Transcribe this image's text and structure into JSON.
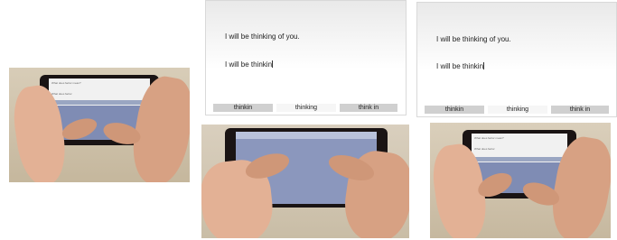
{
  "panels": [
    {
      "sentence": "I will be thinking of you.",
      "typed": "I will be thinkin",
      "suggestions": [
        "thinkin",
        "thinking",
        "think in"
      ]
    },
    {
      "sentence": "I will be thinking of you.",
      "typed": "I will be thinkin",
      "suggestions": [
        "thinkin",
        "thinking",
        "think in"
      ]
    }
  ],
  "colors": {
    "skin": "#e3b195",
    "phone": "#1a1414",
    "keyboard": "#7f8cb4",
    "suggestion_side": "#d0d0d0"
  }
}
